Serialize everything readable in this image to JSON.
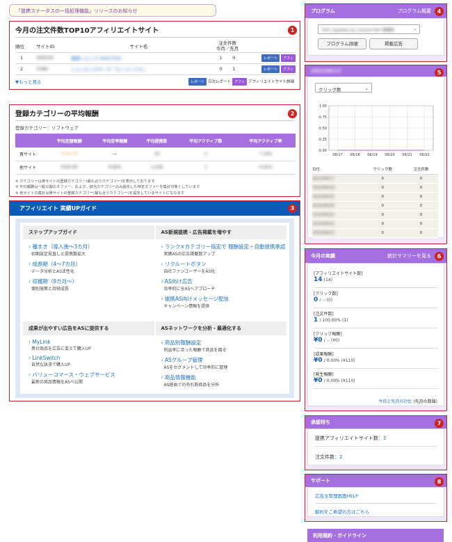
{
  "notice": "「提携ステータスの一括処理機能」リリースのお知らせ",
  "top10": {
    "title": "今月の注文件数TOP10アフィリエイトサイト",
    "col_rank": "順位",
    "col_siteid": "サイトID",
    "col_sitename": "サイト名",
    "col_orders_l1": "注文件数",
    "col_orders_l2": "今月／先月",
    "rows": [
      {
        "rank": "1",
        "siteid": "356234",
        "name": "健康ショップ-RAKUTEN",
        "cur": "1",
        "prev": "0"
      },
      {
        "rank": "2",
        "siteid": "3186",
        "name": "ショッピングサーチ「らくらくナビ」",
        "cur": "0",
        "prev": "1"
      }
    ],
    "btn_report": "レポート",
    "btn_affi": "アフィ",
    "more": "▼もっと見る",
    "legend_report": "日次レポート",
    "legend_affi": "アフィリエイトサイト詳細"
  },
  "reward": {
    "title": "登録カテゴリーの平均報酬",
    "category": "登録カテゴリー：ソフトウェア",
    "headers": [
      "",
      "平均定額報酬",
      "平均定率報酬",
      "平均提携数",
      "平均アクティブ数",
      "平均アクティブ率"
    ],
    "rows": [
      [
        "貴サイト",
        "¥100,00",
        "―",
        "19",
        "1",
        "7.14%"
      ],
      [
        "他サイト",
        "¥335.85",
        "9.66%",
        "1,238",
        "1",
        "0.01%"
      ]
    ],
    "notes": [
      "カテゴリーは貴サイトの登録カテゴリー(最も合うカテゴリー)を表示しております",
      "平均報酬は一般公開のオファー、および、該当カテゴリーのみ設定した特定オファーを集計対象としています",
      "他サイトの集計は貴サイトの登録カテゴリー(最も合うカテゴリー)を設定しているサイトになります"
    ]
  },
  "guide": {
    "title": "アフィリエイト 実績UPガイド",
    "sections": [
      {
        "title": "ステップアップガイド",
        "items": [
          {
            "link": "種まき（導入後～3カ月）",
            "desc": "初期設定見直しと提携数拡大"
          },
          {
            "link": "成長期（4～7カ月）",
            "desc": "データ分析とAS活性化"
          },
          {
            "link": "収穫期（8カ月～）",
            "desc": "個別施策と持続成長"
          }
        ]
      },
      {
        "title": "AS新規提携・広告掲載を増やす",
        "items": [
          {
            "link": "ランク×カテゴリー指定で 報酬設定・自動提携承認",
            "desc": "実績ASの広告掲載数アップ"
          },
          {
            "link": "リクルートボタン",
            "desc": "自社ファンユーザーをAS化"
          },
          {
            "link": "AS向け広告",
            "desc": "効率的に全ASへアプローチ"
          },
          {
            "link": "提携AS向けメッセージ配信",
            "desc": "キャンペーン情報を提供"
          }
        ]
      },
      {
        "title": "成果が出やすい広告をASに提供する",
        "items": [
          {
            "link": "MyLink",
            "desc": "貴社商品を広告に変えて購入UP"
          },
          {
            "link": "LinkSwitch",
            "desc": "自然な訴求で購入UP"
          },
          {
            "link": "バリューコマース・ウェブサービス",
            "desc": "最新の商品情報をASへ公開"
          }
        ]
      },
      {
        "title": "ASネットワークを分析・最適化する",
        "items": [
          {
            "link": "商品別報酬設定",
            "desc": "利益率に合った報酬で商品を図る"
          },
          {
            "link": "ASグループ管理",
            "desc": "ASをセグメントして効率的に管理"
          },
          {
            "link": "商品情報機能",
            "desc": "AS経由での売れ筋商品を分析"
          }
        ]
      }
    ]
  },
  "program": {
    "title": "プログラム",
    "link": "プログラム概要",
    "select": "*597_Updated_for_Charter*597 管理用",
    "btn_detail": "プログラム詳細",
    "btn_ads": "掲載広告"
  },
  "stats": {
    "title": "2022/06/17",
    "metric": "クリック数",
    "yticks": [
      "1.00",
      "0.75",
      "0.50",
      "0.25",
      "0.00"
    ],
    "xticks": [
      "06/17",
      "06/18",
      "06/19",
      "06/20",
      "06/21",
      "06/22"
    ],
    "chart_data": {
      "type": "line",
      "title": "",
      "xlabel": "",
      "ylabel": "",
      "categories": [
        "06/17",
        "06/18",
        "06/19",
        "06/20",
        "06/21",
        "06/22"
      ],
      "series": [
        {
          "values": [
            0,
            0,
            0,
            0,
            0,
            0
          ]
        }
      ],
      "ylim": [
        0,
        1
      ]
    },
    "cols": [
      "日付",
      "クリック数",
      "注文件数"
    ],
    "rows": [
      [
        "2022/06/17",
        "0",
        "0"
      ],
      [
        "2022/06/18",
        "0",
        "0"
      ],
      [
        "2022/06/19",
        "0",
        "0"
      ],
      [
        "2022/06/20",
        "0",
        "0"
      ],
      [
        "2022/06/21",
        "0",
        "0"
      ],
      [
        "2022/06/22",
        "0",
        "0"
      ],
      [
        "2022/06/23",
        "0",
        "0"
      ]
    ]
  },
  "today": {
    "title": "今月の実績",
    "link": "統計サマリーを見る",
    "items": [
      {
        "label": "[アフィリエイトサイト数]",
        "main": "14",
        "sub": "(14)"
      },
      {
        "label": "[クリック数]",
        "main": "0",
        "sub": "/ -- (0)"
      },
      {
        "label": "[注文件数]",
        "main": "1",
        "sub": "/ 100.00% (1)"
      },
      {
        "label": "[クリック報酬]",
        "main": "¥0",
        "sub": "/ -- (¥0)"
      },
      {
        "label": "[成果報酬]",
        "main": "¥0",
        "sub": "/ 0.00% (¥110)"
      },
      {
        "label": "[発生報酬]",
        "main": "¥0",
        "sub": "/ 0.00% (¥110)"
      }
    ],
    "footer_link": "今月と先月の対比",
    "footer_text": "(先月の数値)"
  },
  "pending": {
    "title": "承認待ち",
    "l1": "提携アフィリエイトサイト数：",
    "v1": "3",
    "l2": "注文件数：",
    "v2": "2"
  },
  "support": {
    "title": "サポート",
    "links": [
      "広告主管理画面HELP",
      "解約をご希望の方はこちら"
    ]
  },
  "terms": "利用規約・ガイドライン",
  "badges": [
    "1",
    "2",
    "3",
    "4",
    "5",
    "6",
    "7",
    "8"
  ]
}
